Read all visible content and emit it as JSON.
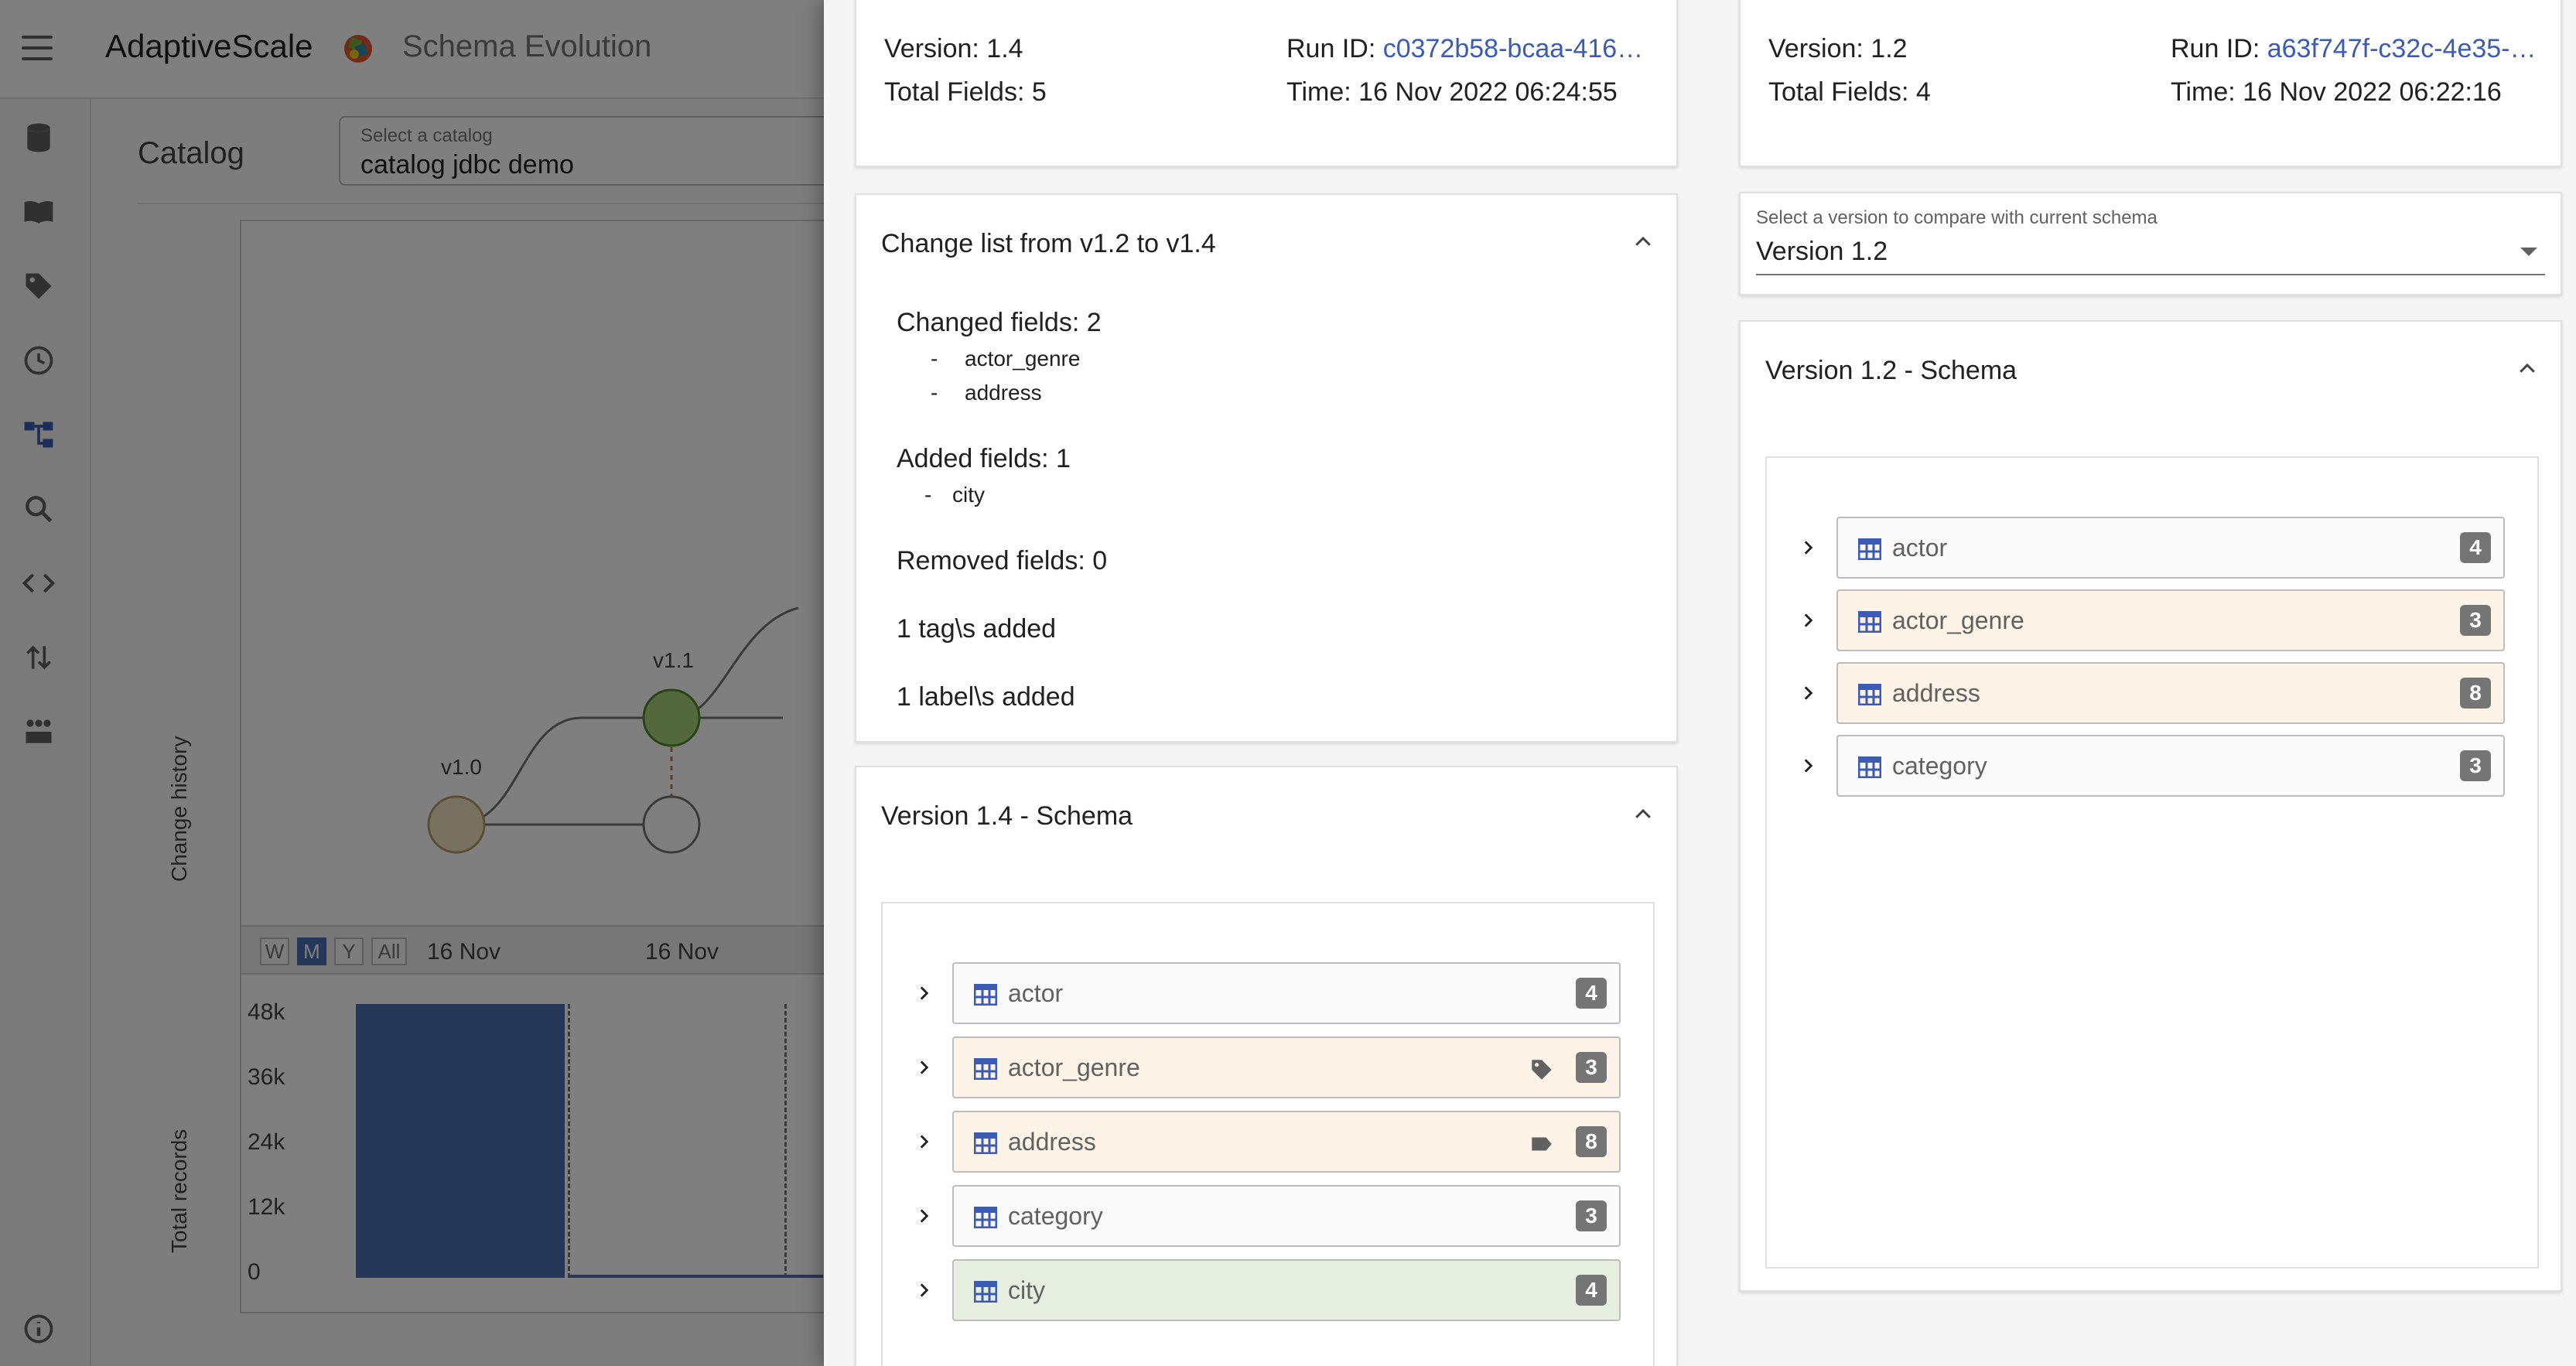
{
  "app": {
    "brand": "AdaptiveScale",
    "page_title": "Schema Evolution",
    "catalog_heading": "Catalog",
    "catalog_select": {
      "label": "Select a catalog",
      "value": "catalog jdbc demo"
    },
    "graph": {
      "y_axis_label": "Change history",
      "node_labels": [
        "v1.0",
        "v1.1"
      ],
      "range_buttons": [
        "W",
        "M",
        "Y",
        "All"
      ],
      "active_range": "M",
      "dates": [
        "16 Nov",
        "16 Nov"
      ]
    },
    "records_chart": {
      "y_axis_label": "Total records",
      "y_ticks": [
        "48k",
        "36k",
        "24k",
        "12k",
        "0"
      ]
    }
  },
  "sidebar": {
    "icons": [
      "database-icon",
      "book-icon",
      "tag-icon",
      "history-icon",
      "schema-tree-icon",
      "search-icon",
      "code-icon",
      "swap-icon",
      "network-icon",
      "info-icon"
    ],
    "active": "schema-tree-icon"
  },
  "current": {
    "version": "Version: 1.4",
    "run_id_label": "Run ID:",
    "run_id": "c0372b58-bcaa-416…",
    "total_fields": "Total Fields: 5",
    "time": "Time: 16 Nov 2022 06:24:55"
  },
  "compare": {
    "version": "Version: 1.2",
    "run_id_label": "Run ID:",
    "run_id": "a63f747f-c32c-4e35-…",
    "total_fields": "Total Fields: 4",
    "time": "Time: 16 Nov 2022 06:22:16",
    "select_label": "Select a version to compare with current schema",
    "select_value": "Version 1.2"
  },
  "change_list": {
    "title": "Change list from v1.2 to v1.4",
    "changed_title": "Changed fields: 2",
    "changed": [
      "actor_genre",
      "address"
    ],
    "added_title": "Added fields: 1",
    "added": [
      "city"
    ],
    "removed_title": "Removed fields: 0",
    "tags_added": "1 tag\\s added",
    "labels_added": "1 label\\s added"
  },
  "schema_current": {
    "title": "Version 1.4 - Schema",
    "tables": [
      {
        "name": "actor",
        "count": "4",
        "status": "unchanged",
        "icon": null
      },
      {
        "name": "actor_genre",
        "count": "3",
        "status": "changed",
        "icon": "tag-icon"
      },
      {
        "name": "address",
        "count": "8",
        "status": "changed",
        "icon": "label-icon"
      },
      {
        "name": "category",
        "count": "3",
        "status": "unchanged",
        "icon": null
      },
      {
        "name": "city",
        "count": "4",
        "status": "added",
        "icon": null
      }
    ]
  },
  "schema_compare": {
    "title": "Version 1.2 - Schema",
    "tables": [
      {
        "name": "actor",
        "count": "4",
        "status": "unchanged"
      },
      {
        "name": "actor_genre",
        "count": "3",
        "status": "changed"
      },
      {
        "name": "address",
        "count": "8",
        "status": "changed"
      },
      {
        "name": "category",
        "count": "3",
        "status": "unchanged"
      }
    ]
  },
  "colors": {
    "accent": "#3b5bb5",
    "changed_row": "#fdf3e6",
    "added_row": "#e6efe0",
    "badge": "#757575"
  }
}
